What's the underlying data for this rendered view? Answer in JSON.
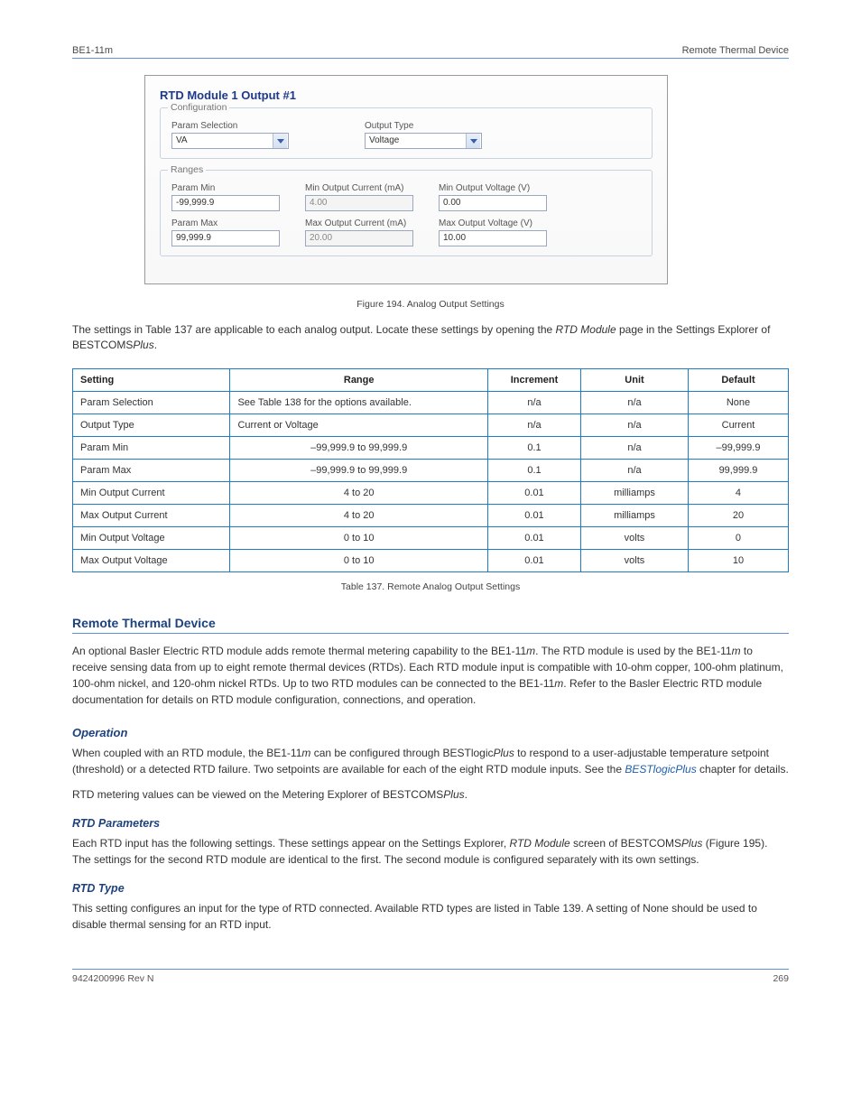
{
  "header": {
    "left": "BE1-11m",
    "right": "Remote Thermal Device"
  },
  "figure": {
    "title": "RTD Module 1 Output #1",
    "config_legend": "Configuration",
    "param_sel_label": "Param Selection",
    "param_sel_value": "VA",
    "output_type_label": "Output Type",
    "output_type_value": "Voltage",
    "ranges_legend": "Ranges",
    "param_min_label": "Param Min",
    "param_min_value": "-99,999.9",
    "min_out_current_label": "Min Output Current (mA)",
    "min_out_current_value": "4.00",
    "min_out_voltage_label": "Min Output Voltage (V)",
    "min_out_voltage_value": "0.00",
    "param_max_label": "Param Max",
    "param_max_value": "99,999.9",
    "max_out_current_label": "Max Output Current (mA)",
    "max_out_current_value": "20.00",
    "max_out_voltage_label": "Max Output Voltage (V)",
    "max_out_voltage_value": "10.00",
    "caption": "Figure 194. Analog Output Settings"
  },
  "intro": {
    "text": "The settings in Table 137 are applicable to each analog output. Locate these settings by opening the ",
    "ital": "RTD Module",
    "text2": " page in the Settings Explorer of BESTCOMS",
    "ital2": "Plus",
    "text3": "."
  },
  "table": {
    "caption": "Table 137. Remote Analog Output Settings",
    "headers": [
      "Setting",
      "Range",
      "Increment",
      "Unit",
      "Default"
    ],
    "rows": [
      {
        "s": "Param Selection",
        "r": "See Table 138 for the options available.",
        "i": "n/a",
        "u": "n/a",
        "d": "None"
      },
      {
        "s": "Output Type",
        "r": "Current or Voltage",
        "i": "n/a",
        "u": "n/a",
        "d": "Current"
      },
      {
        "s": "Param Min",
        "r": "–99,999.9 to 99,999.9",
        "i": "0.1",
        "u": "n/a",
        "d": "–99,999.9"
      },
      {
        "s": "Param Max",
        "r": "–99,999.9 to 99,999.9",
        "i": "0.1",
        "u": "n/a",
        "d": "99,999.9"
      },
      {
        "s": "Min Output Current",
        "r": "4 to 20",
        "i": "0.01",
        "u": "milliamps",
        "d": "4"
      },
      {
        "s": "Max Output Current",
        "r": "4 to 20",
        "i": "0.01",
        "u": "milliamps",
        "d": "20"
      },
      {
        "s": "Min Output Voltage",
        "r": "0 to 10",
        "i": "0.01",
        "u": "volts",
        "d": "0"
      },
      {
        "s": "Max Output Voltage",
        "r": "0 to 10",
        "i": "0.01",
        "u": "volts",
        "d": "10"
      }
    ]
  },
  "section": {
    "title": "Remote Thermal Device",
    "p1_1": "An optional Basler Electric RTD module adds remote thermal metering capability to the BE1-11",
    "p1_ital": "m",
    "p1_2": ". The RTD module is used by the BE1-11",
    "p1_3": " to receive sensing data from up to eight remote thermal devices (RTDs). Each RTD module input is compatible with 10-ohm copper, 100-ohm platinum, 100-ohm nickel, and 120-ohm nickel RTDs. Up to two RTD modules can be connected to the BE1-11",
    "p1_4": ". Refer to the Basler Electric RTD module documentation for details on RTD module configuration, connections, and operation.",
    "sub1": "Operation",
    "p2_1": "When coupled with an RTD module, the BE1-11",
    "p2_2": " can be configured through BESTlogic",
    "p2_3": " to respond to a user-adjustable temperature setpoint (threshold) or a detected RTD failure. Two setpoints are available for each of the eight RTD module inputs. See the ",
    "p2_link": "BESTlogicPlus",
    "p2_4": " chapter for details.",
    "p3": "RTD metering values can be viewed on the Metering Explorer of BESTCOMSPlus.",
    "sub2": "RTD Parameters",
    "p4_1": "Each RTD input has the following settings. These settings appear on the Settings Explorer, ",
    "p4_ital": "RTD Module",
    "p4_2": " screen of BESTCOMS",
    "p4_3": "Plus",
    "p4_4": " (Figure 195). The settings for the second RTD module are identical to the first. The second module is configured separately with its own settings.",
    "sub3": "RTD Type",
    "p5": "This setting configures an input for the type of RTD connected. Available RTD types are listed in Table 139. A setting of None should be used to disable thermal sensing for an RTD input."
  },
  "footer": {
    "left": "9424200996 Rev N",
    "right": "269"
  }
}
